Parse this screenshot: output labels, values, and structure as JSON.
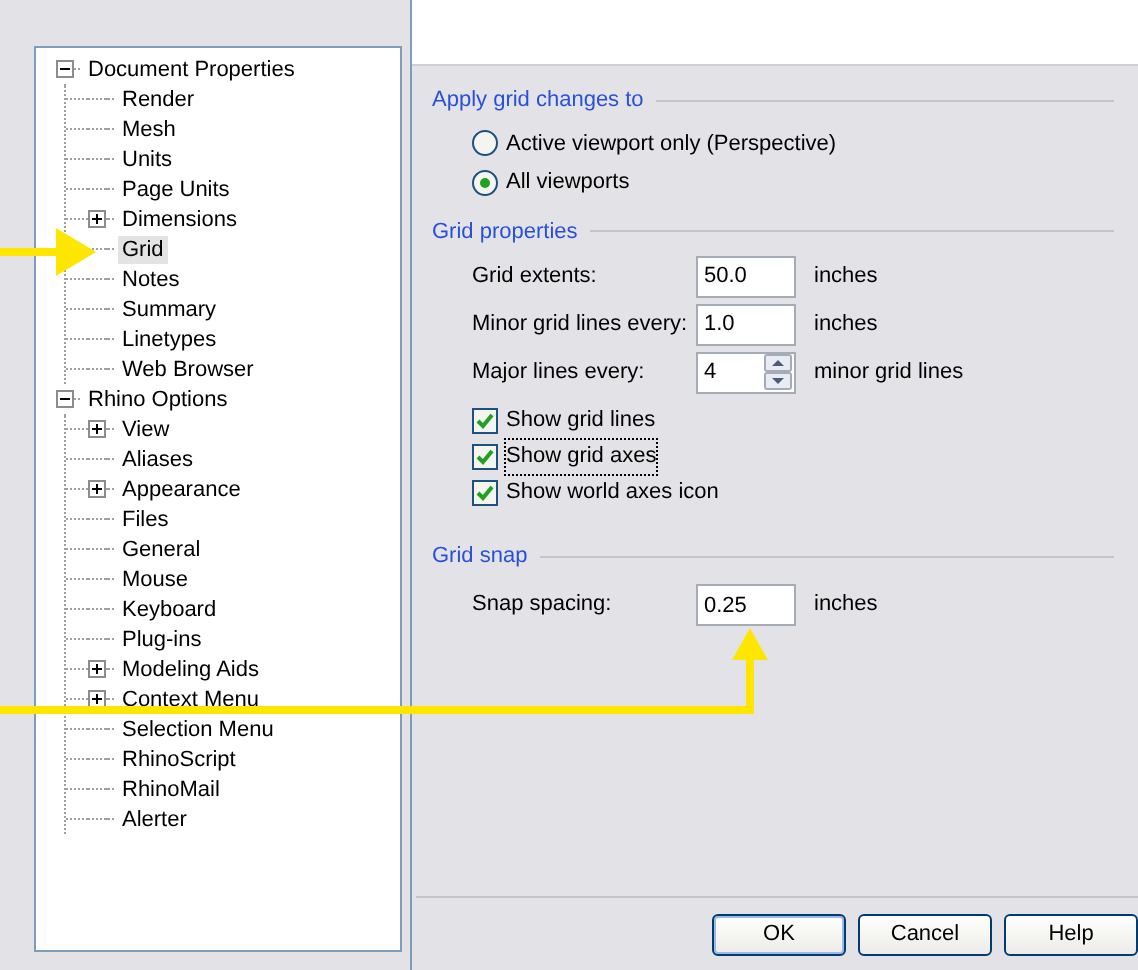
{
  "tree": [
    {
      "label": "Document Properties",
      "kind": "branch",
      "expanded": true,
      "selected": false,
      "children": [
        {
          "label": "Render",
          "kind": "leaf",
          "selected": false
        },
        {
          "label": "Mesh",
          "kind": "leaf",
          "selected": false
        },
        {
          "label": "Units",
          "kind": "leaf",
          "selected": false
        },
        {
          "label": "Page Units",
          "kind": "leaf",
          "selected": false
        },
        {
          "label": "Dimensions",
          "kind": "branch",
          "expanded": false,
          "selected": false
        },
        {
          "label": "Grid",
          "kind": "leaf",
          "selected": true
        },
        {
          "label": "Notes",
          "kind": "leaf",
          "selected": false
        },
        {
          "label": "Summary",
          "kind": "leaf",
          "selected": false
        },
        {
          "label": "Linetypes",
          "kind": "leaf",
          "selected": false
        },
        {
          "label": "Web Browser",
          "kind": "leaf",
          "selected": false
        }
      ]
    },
    {
      "label": "Rhino Options",
      "kind": "branch",
      "expanded": true,
      "selected": false,
      "children": [
        {
          "label": "View",
          "kind": "branch",
          "expanded": false,
          "selected": false
        },
        {
          "label": "Aliases",
          "kind": "leaf",
          "selected": false
        },
        {
          "label": "Appearance",
          "kind": "branch",
          "expanded": false,
          "selected": false
        },
        {
          "label": "Files",
          "kind": "leaf",
          "selected": false
        },
        {
          "label": "General",
          "kind": "leaf",
          "selected": false
        },
        {
          "label": "Mouse",
          "kind": "leaf",
          "selected": false
        },
        {
          "label": "Keyboard",
          "kind": "leaf",
          "selected": false
        },
        {
          "label": "Plug-ins",
          "kind": "leaf",
          "selected": false
        },
        {
          "label": "Modeling Aids",
          "kind": "branch",
          "expanded": false,
          "selected": false
        },
        {
          "label": "Context Menu",
          "kind": "branch",
          "expanded": false,
          "selected": false
        },
        {
          "label": "Selection Menu",
          "kind": "leaf",
          "selected": false
        },
        {
          "label": "RhinoScript",
          "kind": "leaf",
          "selected": false
        },
        {
          "label": "RhinoMail",
          "kind": "leaf",
          "selected": false
        },
        {
          "label": "Alerter",
          "kind": "leaf",
          "selected": false
        }
      ]
    }
  ],
  "apply_group": {
    "title": "Apply grid changes to",
    "options": [
      {
        "label": "Active viewport only (Perspective)",
        "selected": false
      },
      {
        "label": "All viewports",
        "selected": true
      }
    ]
  },
  "grid_properties": {
    "title": "Grid properties",
    "fields": [
      {
        "label": "Grid extents:",
        "value": "50.0",
        "unit": "inches",
        "kind": "text"
      },
      {
        "label": "Minor grid lines every:",
        "value": "1.0",
        "unit": "inches",
        "kind": "text"
      },
      {
        "label": "Major lines every:",
        "value": "4",
        "unit": "minor grid lines",
        "kind": "spinner"
      }
    ],
    "checkboxes": [
      {
        "label": "Show grid lines",
        "checked": true,
        "focused": false
      },
      {
        "label": "Show grid axes",
        "checked": true,
        "focused": true
      },
      {
        "label": "Show world axes icon",
        "checked": true,
        "focused": false
      }
    ]
  },
  "grid_snap": {
    "title": "Grid snap",
    "fields": [
      {
        "label": "Snap spacing:",
        "value": "0.25",
        "unit": "inches",
        "kind": "text"
      }
    ]
  },
  "buttons": [
    "OK",
    "Cancel",
    "Help"
  ]
}
